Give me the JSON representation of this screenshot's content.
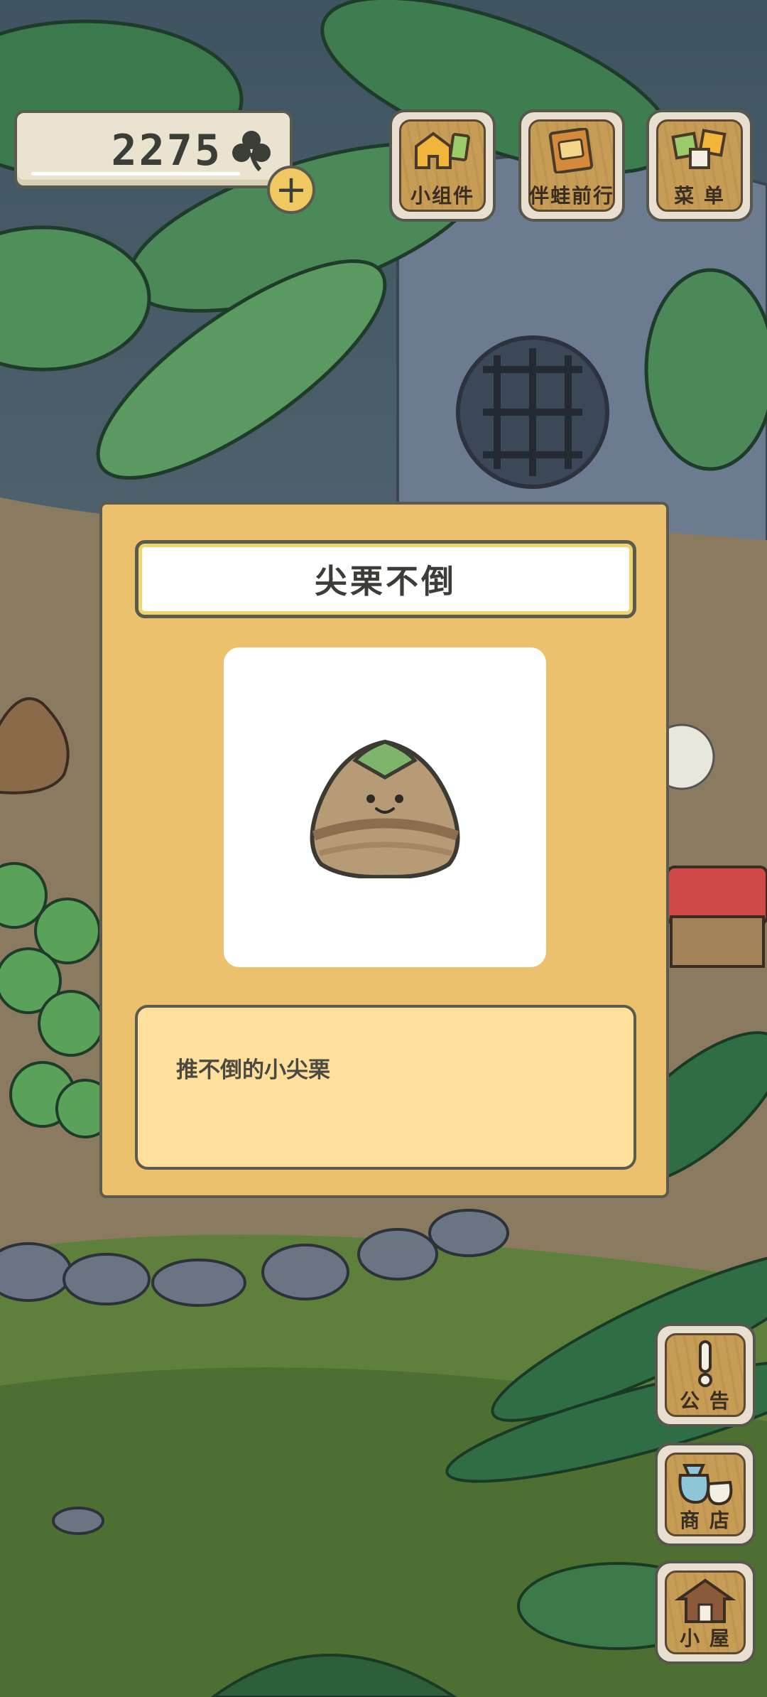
{
  "clover": {
    "count": "2275",
    "add_label": "+"
  },
  "top_buttons": [
    {
      "label": "小组件",
      "icon": "widget-icon"
    },
    {
      "label": "伴蛙前行",
      "icon": "album-icon"
    },
    {
      "label": "菜 单",
      "icon": "menu-icon"
    }
  ],
  "side_buttons": [
    {
      "label": "公 告",
      "icon": "exclamation-icon"
    },
    {
      "label": "商 店",
      "icon": "shop-bags-icon"
    },
    {
      "label": "小 屋",
      "icon": "house-icon"
    }
  ],
  "item_card": {
    "title": "尖栗不倒",
    "description": "推不倒的小尖栗",
    "item_icon": "chestnut-tumbler-icon"
  },
  "colors": {
    "card_bg": "#ecc16e",
    "desc_bg": "#ffdf9c",
    "outline": "#5b5a4e",
    "wood": "#c79c55"
  }
}
